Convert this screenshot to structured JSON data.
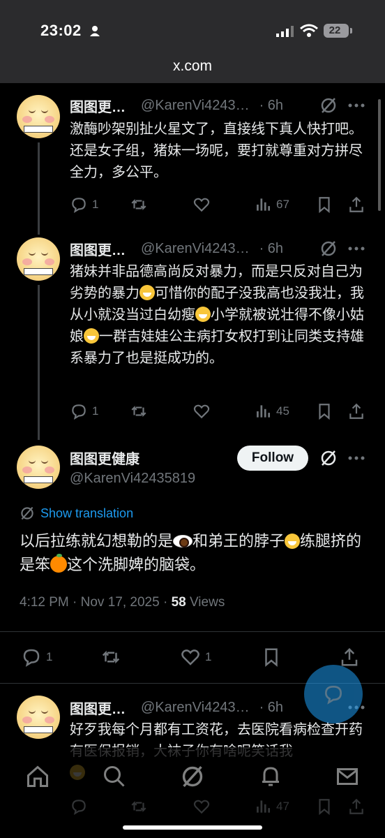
{
  "status_bar": {
    "time": "23:02",
    "battery": "22"
  },
  "browser": {
    "url": "x.com"
  },
  "tweets": [
    {
      "name": "图图更…",
      "handle": "@KarenVi4243…",
      "time": "· 6h",
      "text": "激酶吵架别扯火星文了，直接线下真人快打吧。还是女子组，猪妹一场呢，要打就尊重对方拼尽全力，多公平。",
      "replies": "1",
      "views": "67"
    },
    {
      "name": "图图更…",
      "handle": "@KarenVi4243…",
      "time": "· 6h",
      "text_parts": [
        "猪妹并非品德高尚反对暴力，而是只反对自己为劣势的暴力",
        "可惜你的配子没我高也没我壮，我从小就没当过白幼瘦",
        "小学就被说壮得不像小姑娘",
        "一群吉娃娃公主病打女权打到让同类支持雄系暴力了也是挺成功的。"
      ],
      "replies": "1",
      "views": "45"
    }
  ],
  "focused": {
    "name": "图图更健康",
    "handle": "@KarenVi42435819",
    "follow_label": "Follow",
    "translate_label": "Show translation",
    "text_parts": [
      "以后拉练就幻想勒的是",
      "和弟王的脖子",
      "练腿挤的是笨",
      "这个洗脚婢的脑袋。"
    ],
    "timestamp": "4:12 PM · Nov 17, 2025 · ",
    "views_count": "58",
    "views_label": " Views",
    "replies": "1",
    "likes": "1"
  },
  "last_tweet": {
    "name": "图图更…",
    "handle": "@KarenVi4243…",
    "time": "· 6h",
    "text": "好歹我每个月都有工资花，去医院看病检查开药有医保报销，大袜子你有啥呢笑话我",
    "views": "47"
  },
  "icons": [
    "person-icon",
    "signal-icon",
    "wifi-icon",
    "grok-icon",
    "more-icon",
    "reply-icon",
    "repost-icon",
    "like-icon",
    "views-icon",
    "bookmark-icon",
    "share-icon",
    "translate-icon",
    "home-icon",
    "search-icon",
    "notifications-icon",
    "messages-icon",
    "compose-icon"
  ]
}
